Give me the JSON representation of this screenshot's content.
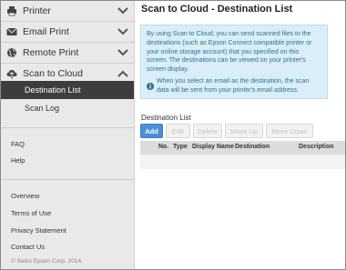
{
  "sidebar": {
    "items": [
      {
        "label": "Printer",
        "icon": "printer-icon",
        "chevron": "chevron-down-icon"
      },
      {
        "label": "Email Print",
        "icon": "envelope-icon",
        "chevron": "chevron-down-icon"
      },
      {
        "label": "Remote Print",
        "icon": "globe-icon",
        "chevron": "chevron-down-icon"
      },
      {
        "label": "Scan to Cloud",
        "icon": "cloud-upload-icon",
        "chevron": "chevron-up-icon"
      }
    ],
    "subitems": [
      {
        "label": "Destination List",
        "active": true
      },
      {
        "label": "Scan Log",
        "active": false
      }
    ],
    "links_top": [
      "FAQ",
      "Help"
    ],
    "links_bottom": [
      "Overview",
      "Terms of Use",
      "Privacy Statement",
      "Contact Us"
    ],
    "copyright": "© Seiko Epson Corp. 2014."
  },
  "main": {
    "title": "Scan to Cloud - Destination List",
    "info_text": "By using Scan to Cloud, you can send scanned files to the destinations (such as Epson Connect compatible printer or your online storage account) that you specified on this screen. The destinations can be viewed on your printer's screen display.",
    "info_note": "When you select an email as the destination, the scan data will be sent from your printer's email address.",
    "list_label": "Destination List",
    "buttons": {
      "add": "Add",
      "edit": "Edit",
      "delete": "Delete",
      "move_up": "Move Up",
      "move_down": "Move Down"
    },
    "table_headers": {
      "no": "No.",
      "type": "Type",
      "display_name": "Display Name",
      "destination": "Destination",
      "description": "Description"
    }
  },
  "colors": {
    "accent": "#4a90d9",
    "active_nav": "#3d3d3d",
    "info_bg": "#d9eef7",
    "info_text": "#31708f"
  }
}
